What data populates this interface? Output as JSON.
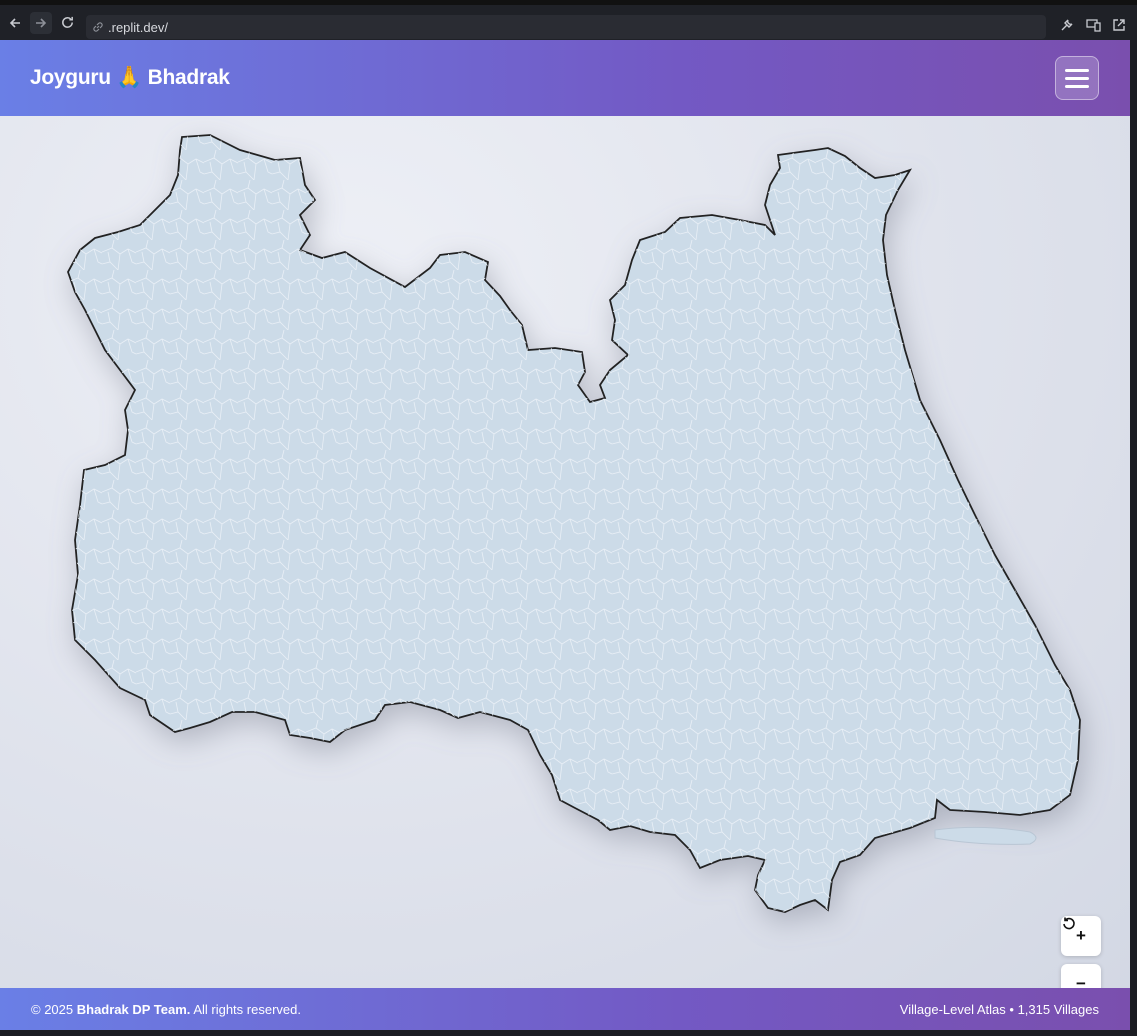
{
  "browser": {
    "url": ".replit.dev/",
    "icons": [
      "back-arrow-icon",
      "forward-arrow-icon",
      "reload-icon",
      "link-icon",
      "wrench-icon",
      "devices-icon",
      "external-link-icon"
    ]
  },
  "header": {
    "brand": "Joyguru 🙏 Bhadrak",
    "menu_icon": "hamburger-icon"
  },
  "map": {
    "region": "Bhadrak district village boundaries",
    "fill_color": "#ccdbe8",
    "outline_color": "#222222",
    "controls": {
      "zoom_in": "+",
      "zoom_out": "−",
      "reset_icon": "reset-rotate-icon"
    }
  },
  "footer": {
    "copyright_prefix": "© 2025 ",
    "team": "Bhadrak DP Team.",
    "rights": " All rights reserved.",
    "atlas_info": "Village-Level Atlas • 1,315 Villages"
  },
  "colors": {
    "header_gradient_start": "#6a7fe6",
    "header_gradient_end": "#7a4fae",
    "background": "#e2e5ee"
  }
}
